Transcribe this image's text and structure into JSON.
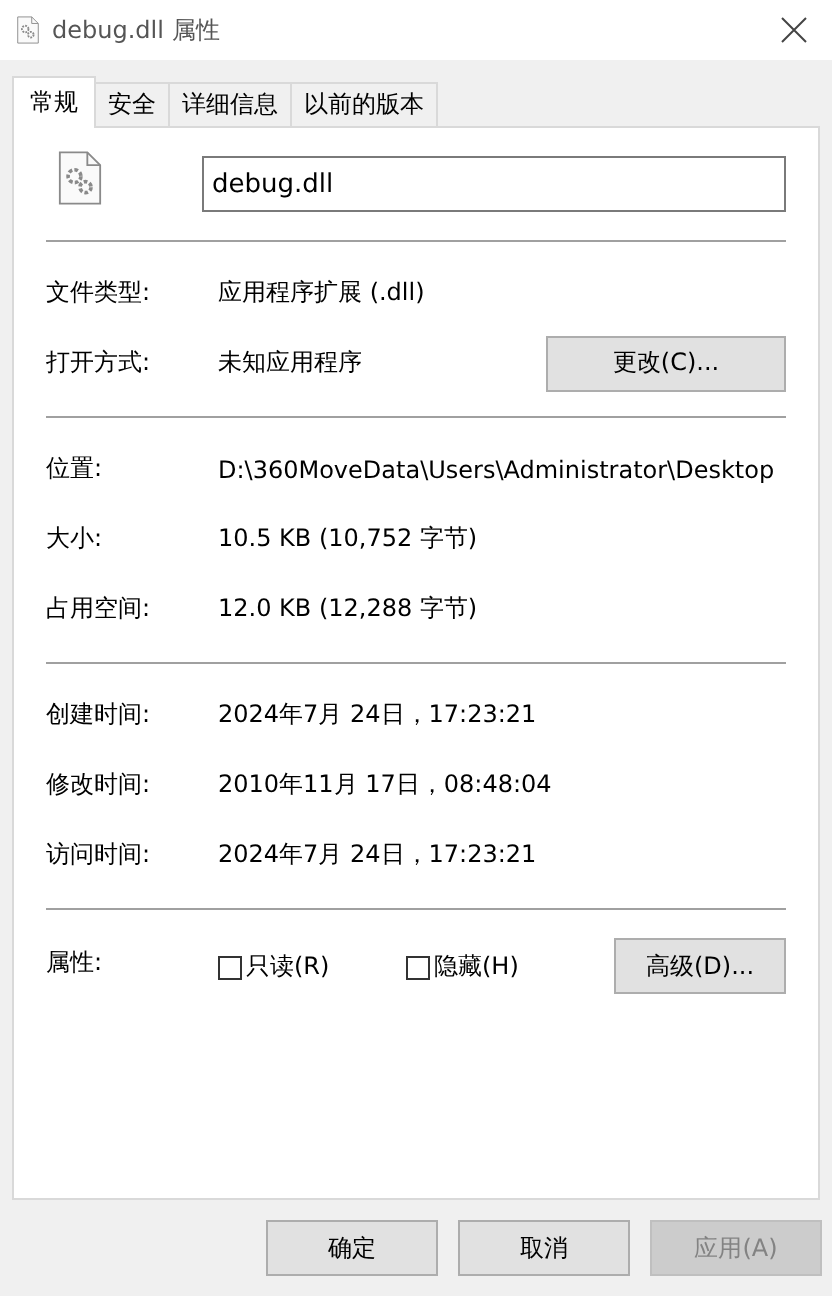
{
  "window": {
    "title": "debug.dll 属性"
  },
  "tabs": [
    {
      "label": "常规",
      "selected": true
    },
    {
      "label": "安全",
      "selected": false
    },
    {
      "label": "详细信息",
      "selected": false
    },
    {
      "label": "以前的版本",
      "selected": false
    }
  ],
  "file_name": {
    "value": "debug.dll"
  },
  "sections": [
    {
      "rows": [
        {
          "label": "文件类型:",
          "value": "应用程序扩展 (.dll)"
        },
        {
          "label": "打开方式:",
          "value": "未知应用程序",
          "button": "更改(C)..."
        }
      ]
    },
    {
      "rows": [
        {
          "label": "位置:",
          "value": "D:\\360MoveData\\Users\\Administrator\\Desktop"
        },
        {
          "label": "大小:",
          "value": "10.5 KB (10,752 字节)"
        },
        {
          "label": "占用空间:",
          "value": "12.0 KB (12,288 字节)"
        }
      ]
    },
    {
      "rows": [
        {
          "label": "创建时间:",
          "value": "2024年7月 24日，17:23:21"
        },
        {
          "label": "修改时间:",
          "value": "2010年11月 17日，08:48:04"
        },
        {
          "label": "访问时间:",
          "value": "2024年7月 24日，17:23:21"
        }
      ]
    }
  ],
  "attributes": {
    "label": "属性:",
    "checkboxes": [
      {
        "label": "只读(R)",
        "checked": false
      },
      {
        "label": "隐藏(H)",
        "checked": false
      }
    ],
    "button": "高级(D)..."
  },
  "buttons": [
    {
      "label": "确定",
      "disabled": false
    },
    {
      "label": "取消",
      "disabled": false
    },
    {
      "label": "应用(A)",
      "disabled": true
    }
  ]
}
